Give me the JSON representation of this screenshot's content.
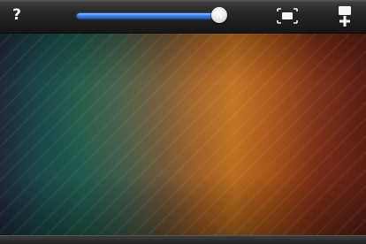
{
  "toolbar": {
    "help_label": "?",
    "help_icon": "question-mark-icon",
    "fit_icon": "fit-to-screen-icon",
    "add_icon": "add-wallpaper-icon"
  },
  "zoom_slider": {
    "value_fraction": 0.98
  },
  "colors": {
    "slider_fill": "#3f86ea",
    "toolbar_bg": "#262626"
  }
}
